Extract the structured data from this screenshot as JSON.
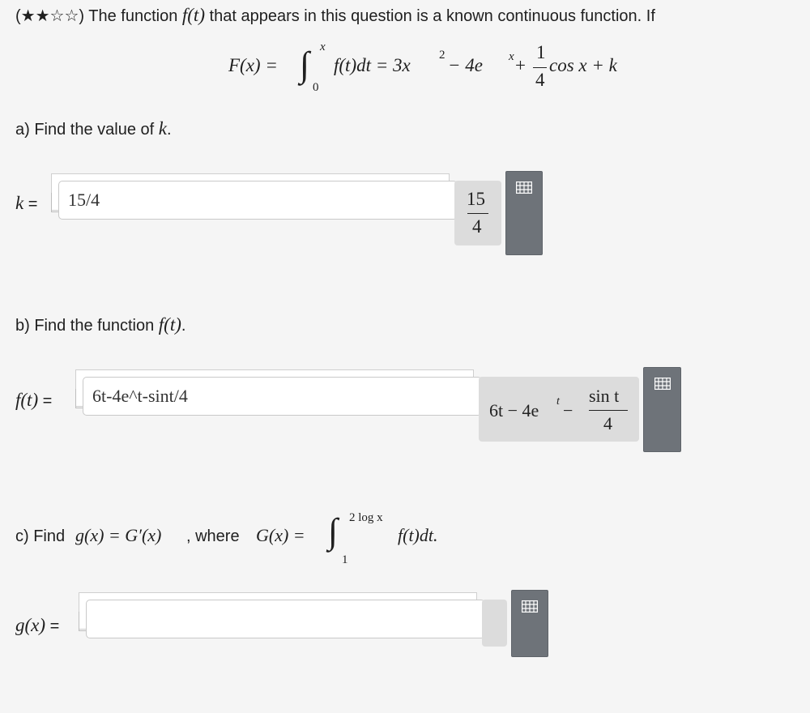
{
  "intro": {
    "stars": "(★★☆☆)",
    "text_before": " The function ",
    "func": "f(t)",
    "text_after": " that appears in this question is a known continuous function. If"
  },
  "equation": {
    "lhs": "F(x) =",
    "upper": "x",
    "lower": "0",
    "integrand": "f(t)dt = 3x",
    "exp2": "2",
    "minus": " − 4e",
    "expx": "x",
    "plus": " +",
    "frac_num": "1",
    "frac_den": "4",
    "tail": "cos x + k"
  },
  "part_a": {
    "prompt": "a) Find the value of ",
    "var": "k",
    "period": ".",
    "label_var": "k",
    "label_eq": " =",
    "input_value": "15/4",
    "preview_num": "15",
    "preview_den": "4"
  },
  "part_b": {
    "prompt": "b) Find the function ",
    "func": "f(t)",
    "period": ".",
    "label_func": "f(t)",
    "label_eq": " =",
    "input_value": "6t-4e^t-sint/4",
    "preview_lead": "6t − 4e",
    "preview_exp": "t",
    "preview_minus": " −",
    "preview_num": "sin t",
    "preview_den": "4"
  },
  "part_c": {
    "prompt": "c) Find ",
    "gx": "g(x) = G′(x)",
    "where": ", where ",
    "Gx": "G(x) =",
    "upper": "2 log x",
    "lower": "1",
    "integrand": "f(t)dt.",
    "label_func": "g(x)",
    "label_eq": " =",
    "input_value": ""
  },
  "icons": {
    "keyboard": "grid-icon"
  },
  "colors": {
    "button": "#6e7379",
    "preview_bg": "#dcdcdc",
    "page_bg": "#f5f5f5"
  }
}
